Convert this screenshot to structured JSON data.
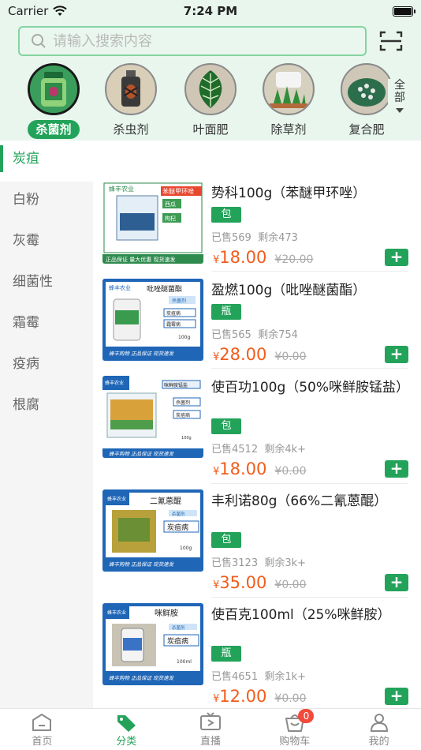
{
  "status": {
    "carrier": "Carrier",
    "time": "7:24 PM"
  },
  "search": {
    "placeholder": "请输入搜索内容"
  },
  "categories": [
    {
      "label": "杀菌剂",
      "active": true
    },
    {
      "label": "杀虫剂",
      "active": false
    },
    {
      "label": "叶面肥",
      "active": false
    },
    {
      "label": "除草剂",
      "active": false
    },
    {
      "label": "复合肥",
      "active": false
    }
  ],
  "all_button": {
    "line1": "全",
    "line2": "部"
  },
  "sidebar": [
    {
      "label": "炭疽",
      "active": true
    },
    {
      "label": "白粉"
    },
    {
      "label": "灰霉"
    },
    {
      "label": "细菌性"
    },
    {
      "label": "霜霉"
    },
    {
      "label": "疫病"
    },
    {
      "label": "根腐"
    }
  ],
  "products": [
    {
      "name": "势科100g（苯醚甲环唑）",
      "unit": "包",
      "sold": "已售569",
      "stock": "剩余473",
      "currency": "¥",
      "price": "18.00",
      "old_price": "¥20.00",
      "img": {
        "brand": "蜂丰农业",
        "title": "苯醚甲环唑",
        "tags": [
          "西瓜",
          "枸杞"
        ],
        "footer": "正品保证 量大优惠 现货速发"
      }
    },
    {
      "name": "盈燃100g（吡唑醚菌酯）",
      "unit": "瓶",
      "sold": "已售565",
      "stock": "剩余754",
      "currency": "¥",
      "price": "28.00",
      "old_price": "¥0.00",
      "img": {
        "brand": "蜂丰农业",
        "title": "吡唑醚菌酯",
        "tags": [
          "杀菌剂",
          "炭疽病",
          "霜霉病"
        ],
        "size": "100g",
        "footer": "蜂丰购物 正品保证 现货速发"
      }
    },
    {
      "name": "使百功100g（50%咪鲜胺锰盐）",
      "unit": "包",
      "sold": "已售4512",
      "stock": "剩余4k+",
      "currency": "¥",
      "price": "18.00",
      "old_price": "¥0.00",
      "img": {
        "brand": "蜂丰农业",
        "title": "咪鲜胺锰盐",
        "tags": [
          "杀菌剂",
          "炭疽病"
        ],
        "size": "100g",
        "footer": "蜂丰购物 正品保证 现货速发"
      }
    },
    {
      "name": "丰利诺80g（66%二氰蒽醌）",
      "unit": "包",
      "sold": "已售3123",
      "stock": "剩余3k+",
      "currency": "¥",
      "price": "35.00",
      "old_price": "¥0.00",
      "img": {
        "brand": "蜂丰农业",
        "title": "二氰蒽醌",
        "tags": [
          "杀菌剂",
          "炭疽病"
        ],
        "size": "100g",
        "footer": "蜂丰购物 正品保证 现货速发"
      }
    },
    {
      "name": "使百克100ml（25%咪鲜胺）",
      "unit": "瓶",
      "sold": "已售4651",
      "stock": "剩余1k+",
      "currency": "¥",
      "price": "12.00",
      "old_price": "¥0.00",
      "img": {
        "brand": "蜂丰农业",
        "title": "咪鲜胺",
        "tags": [
          "杀菌剂",
          "炭疽病"
        ],
        "size": "100ml",
        "footer": "蜂丰购物 正品保证 现货速发"
      }
    }
  ],
  "add_symbol": "+",
  "tabs": [
    {
      "label": "首页",
      "icon": "home-icon"
    },
    {
      "label": "分类",
      "icon": "tag-icon",
      "active": true
    },
    {
      "label": "直播",
      "icon": "tv-icon"
    },
    {
      "label": "购物车",
      "icon": "cart-icon",
      "badge": "0"
    },
    {
      "label": "我的",
      "icon": "user-icon"
    }
  ],
  "colors": {
    "accent": "#23a35a",
    "header_bg": "#e8f6ee",
    "price": "#f25c1c",
    "badge": "#f24a3c"
  }
}
